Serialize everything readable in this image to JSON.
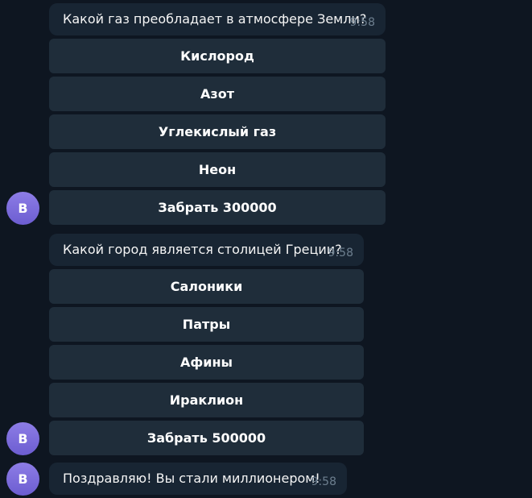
{
  "messages": [
    {
      "question": "Какой газ преобладает в атмосфере Земли?",
      "time": "9:58",
      "buttons": [
        "Кислород",
        "Азот",
        "Углекислый газ",
        "Неон",
        "Забрать 300000"
      ]
    },
    {
      "question": "Какой город является столицей Греции?",
      "time": "9:58",
      "buttons": [
        "Салоники",
        "Патры",
        "Афины",
        "Ираклион",
        "Забрать 500000"
      ]
    },
    {
      "text": "Поздравляю! Вы стали миллионером!",
      "time": "9:58"
    }
  ],
  "avatar": {
    "initial": "B",
    "color": "#7b6ad9"
  }
}
